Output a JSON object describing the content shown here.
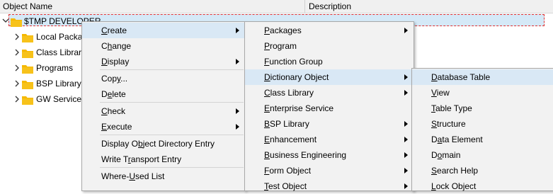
{
  "header": {
    "col_name": "Object Name",
    "col_description": "Description"
  },
  "tree": {
    "root_label": "$TMP DEVELOPER",
    "children": [
      {
        "label": "Local Packages"
      },
      {
        "label": "Class Library"
      },
      {
        "label": "Programs"
      },
      {
        "label": "BSP Library"
      },
      {
        "label": "GW Service"
      }
    ]
  },
  "context_menu": {
    "items": [
      {
        "pre": "",
        "u": "C",
        "post": "reate"
      },
      {
        "pre": "C",
        "u": "h",
        "post": "ange"
      },
      {
        "pre": "",
        "u": "D",
        "post": "isplay"
      },
      {
        "pre": "Cop",
        "u": "y",
        "post": "..."
      },
      {
        "pre": "D",
        "u": "e",
        "post": "lete"
      },
      {
        "pre": "",
        "u": "C",
        "post": "heck"
      },
      {
        "pre": "",
        "u": "E",
        "post": "xecute"
      },
      {
        "pre": "Display O",
        "u": "b",
        "post": "ject Directory Entry"
      },
      {
        "pre": "Write T",
        "u": "r",
        "post": "ansport Entry"
      },
      {
        "pre": "Where-",
        "u": "U",
        "post": "sed List"
      }
    ]
  },
  "create_menu": {
    "items": [
      {
        "pre": "",
        "u": "P",
        "post": "ackages"
      },
      {
        "pre": "",
        "u": "P",
        "post": "rogram"
      },
      {
        "pre": "",
        "u": "F",
        "post": "unction Group"
      },
      {
        "pre": "",
        "u": "D",
        "post": "ictionary Object"
      },
      {
        "pre": "",
        "u": "C",
        "post": "lass Library"
      },
      {
        "pre": "",
        "u": "E",
        "post": "nterprise Service"
      },
      {
        "pre": "",
        "u": "B",
        "post": "SP Library"
      },
      {
        "pre": "",
        "u": "E",
        "post": "nhancement"
      },
      {
        "pre": "",
        "u": "B",
        "post": "usiness Engineering"
      },
      {
        "pre": "",
        "u": "F",
        "post": "orm Object"
      },
      {
        "pre": "",
        "u": "T",
        "post": "est Object"
      }
    ]
  },
  "dictionary_menu": {
    "items": [
      {
        "pre": "",
        "u": "D",
        "post": "atabase Table"
      },
      {
        "pre": "",
        "u": "V",
        "post": "iew"
      },
      {
        "pre": "",
        "u": "T",
        "post": "able Type"
      },
      {
        "pre": "",
        "u": "S",
        "post": "tructure"
      },
      {
        "pre": "D",
        "u": "a",
        "post": "ta Element"
      },
      {
        "pre": "D",
        "u": "o",
        "post": "main"
      },
      {
        "pre": "",
        "u": "S",
        "post": "earch Help"
      },
      {
        "pre": "",
        "u": "L",
        "post": "ock Object"
      }
    ]
  },
  "colors": {
    "folder": "#f5b800",
    "highlight": "#d9e8f5",
    "selected_row": "#d5e9f7",
    "focus_border": "#e03030"
  }
}
